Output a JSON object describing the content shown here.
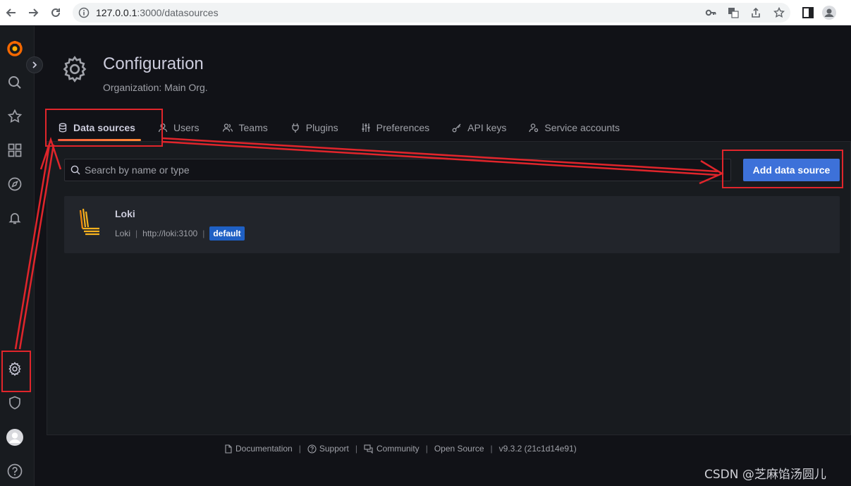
{
  "browser": {
    "url_host": "127.0.0.1",
    "url_path": ":3000/datasources"
  },
  "page": {
    "title": "Configuration",
    "subtitle": "Organization: Main Org."
  },
  "tabs": [
    {
      "label": "Data sources",
      "icon": "database-icon",
      "active": true
    },
    {
      "label": "Users",
      "icon": "user-icon",
      "active": false
    },
    {
      "label": "Teams",
      "icon": "users-icon",
      "active": false
    },
    {
      "label": "Plugins",
      "icon": "plug-icon",
      "active": false
    },
    {
      "label": "Preferences",
      "icon": "sliders-icon",
      "active": false
    },
    {
      "label": "API keys",
      "icon": "key-icon",
      "active": false
    },
    {
      "label": "Service accounts",
      "icon": "user-cog-icon",
      "active": false
    }
  ],
  "search": {
    "placeholder": "Search by name or type",
    "value": ""
  },
  "add_button": {
    "label": "Add data source"
  },
  "datasources": [
    {
      "name": "Loki",
      "type": "Loki",
      "url": "http://loki:3100",
      "badge": "default"
    }
  ],
  "footer": {
    "documentation": "Documentation",
    "support": "Support",
    "community": "Community",
    "open_source": "Open Source",
    "version": "v9.3.2 (21c1d14e91)"
  },
  "watermark": "CSDN @芝麻馅汤圆儿",
  "colors": {
    "accent": "#3d71d9",
    "annotation_red": "#e0252b",
    "tab_underline": "#ff8833"
  }
}
